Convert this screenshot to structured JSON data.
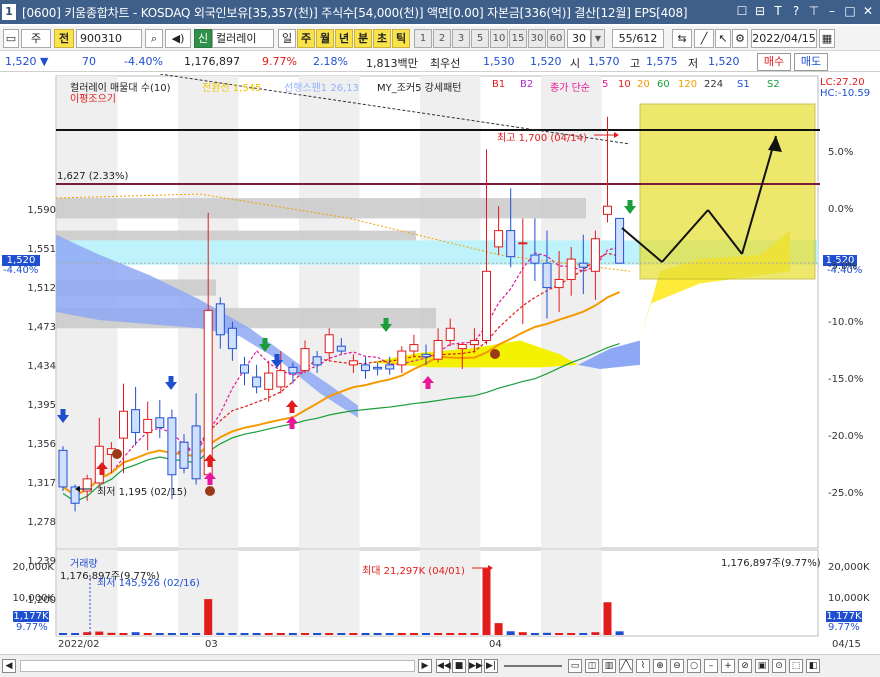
{
  "window": {
    "number": "1",
    "title": "[0600] 키움종합차트 - KOSDAQ 외국인보유[35,357(천)] 주식수[54,000(천)] 액면[0.00] 자본금[336(억)] 결산[12월] EPS[408]",
    "icons": [
      "restore-icon",
      "minimize-icon",
      "text-icon",
      "question-icon",
      "pin-icon",
      "window-minimize-icon",
      "maximize-icon",
      "close-icon"
    ],
    "icon_glyphs": [
      "☐",
      "⊟",
      "T",
      "?",
      "⊤",
      "–",
      "□",
      "✕"
    ]
  },
  "toolbar": {
    "market": "주",
    "jeon": "전",
    "code": "900310",
    "search_glyph": "🔍",
    "sound_glyph": "◀)",
    "new_label": "신",
    "stock_name": "컬러레이",
    "periods": [
      "일",
      "주",
      "월",
      "년",
      "분",
      "초",
      "틱"
    ],
    "intervals": [
      "1",
      "2",
      "3",
      "5",
      "10",
      "15",
      "30",
      "60"
    ],
    "interval_value": "30",
    "page": "55/612",
    "date": "2022/04/15"
  },
  "quote": {
    "price": "1,520",
    "change_arrow": "▼",
    "change": "70",
    "change_pct": "-4.40%",
    "volume": "1,176,897",
    "volume_ratio": "9.77%",
    "amount": "2.18%",
    "amount_value": "1,813백만",
    "best_label": "최우선",
    "best_ask": "1,530",
    "best_bid": "1,520",
    "open_label": "시",
    "open": "1,570",
    "high_label": "고",
    "high": "1,575",
    "low_label": "저",
    "low": "1,520",
    "buy_button": "매수",
    "sell_button": "매도"
  },
  "legend": {
    "name": "컬러레이 매물대 수(10)",
    "second_line": "이평조으기",
    "conversion": "전환선 1,545",
    "lead": "선행스팬1 26,13",
    "pattern": "MY_조커5 강세패턴",
    "b1": "B1",
    "b2": "B2",
    "ma_label": "종가 단순",
    "ma_periods": [
      "5",
      "10",
      "20",
      "60",
      "120",
      "224"
    ],
    "s1": "S1",
    "s2": "S2",
    "lc": "LC:27.20",
    "hc": "HC:-10.59",
    "colors": {
      "ma5": "#e8169a",
      "ma10": "#e21b1b",
      "ma20": "#f59a00",
      "ma60": "#1a9e3a",
      "ma120": "#f0a000",
      "ma224": "#333333",
      "s1": "#1f4fd1",
      "s2": "#1a9e3a"
    }
  },
  "annotations": {
    "high_marker": "최고 1,700 (04/14)",
    "low_marker": "최저 1,195 (02/15)",
    "upper_line": "1,627 (2.33%)",
    "current_left": "1,520",
    "current_left_pct": "-4.40%",
    "current_right": "1,520",
    "current_right_pct": "-4.40%"
  },
  "axes": {
    "left_ticks": [
      "1,590",
      "1,551",
      "1,512",
      "1,473",
      "1,434",
      "1,395",
      "1,356",
      "1,317",
      "1,278",
      "1,239",
      "1,200"
    ],
    "right_ticks": [
      "5.0%",
      "0.0%",
      "-5.0%",
      "-10.0%",
      "-15.0%",
      "-20.0%",
      "-25.0%"
    ],
    "volume_left_ticks": [
      "20,000K",
      "10,000K"
    ],
    "volume_right_ticks": [
      "20,000K",
      "10,000K"
    ],
    "x_labels": [
      "2022/02",
      "03",
      "04"
    ],
    "x_right": "04/15"
  },
  "volume_panel": {
    "title": "거래량",
    "current": "1,176,897주(9.77%)",
    "current_right": "1,176,897주(9.77%)",
    "min_marker": "최저 145,926 (02/16)",
    "max_marker": "최대 21,297K (04/01)",
    "current_k": "1,177K",
    "current_pct": "9.77%"
  },
  "chart_data": {
    "type": "candlestick",
    "ylim": [
      1170,
      1750
    ],
    "candles": [
      {
        "o": 1290,
        "h": 1295,
        "l": 1240,
        "c": 1245
      },
      {
        "o": 1245,
        "h": 1248,
        "l": 1215,
        "c": 1225
      },
      {
        "o": 1240,
        "h": 1260,
        "l": 1228,
        "c": 1255
      },
      {
        "o": 1250,
        "h": 1330,
        "l": 1245,
        "c": 1295
      },
      {
        "o": 1285,
        "h": 1300,
        "l": 1262,
        "c": 1292
      },
      {
        "o": 1305,
        "h": 1372,
        "l": 1262,
        "c": 1338
      },
      {
        "o": 1340,
        "h": 1368,
        "l": 1296,
        "c": 1312
      },
      {
        "o": 1312,
        "h": 1350,
        "l": 1290,
        "c": 1328
      },
      {
        "o": 1330,
        "h": 1352,
        "l": 1305,
        "c": 1318
      },
      {
        "o": 1330,
        "h": 1340,
        "l": 1230,
        "c": 1260
      },
      {
        "o": 1300,
        "h": 1310,
        "l": 1262,
        "c": 1268
      },
      {
        "o": 1320,
        "h": 1360,
        "l": 1248,
        "c": 1255
      },
      {
        "o": 1260,
        "h": 1582,
        "l": 1255,
        "c": 1462
      },
      {
        "o": 1470,
        "h": 1478,
        "l": 1415,
        "c": 1432
      },
      {
        "o": 1440,
        "h": 1448,
        "l": 1400,
        "c": 1415
      },
      {
        "o": 1395,
        "h": 1405,
        "l": 1370,
        "c": 1385
      },
      {
        "o": 1380,
        "h": 1395,
        "l": 1360,
        "c": 1368
      },
      {
        "o": 1365,
        "h": 1400,
        "l": 1350,
        "c": 1385
      },
      {
        "o": 1368,
        "h": 1412,
        "l": 1360,
        "c": 1388
      },
      {
        "o": 1392,
        "h": 1398,
        "l": 1372,
        "c": 1385
      },
      {
        "o": 1388,
        "h": 1425,
        "l": 1385,
        "c": 1415
      },
      {
        "o": 1405,
        "h": 1412,
        "l": 1385,
        "c": 1395
      },
      {
        "o": 1410,
        "h": 1440,
        "l": 1400,
        "c": 1432
      },
      {
        "o": 1418,
        "h": 1428,
        "l": 1408,
        "c": 1412
      },
      {
        "o": 1395,
        "h": 1408,
        "l": 1385,
        "c": 1400
      },
      {
        "o": 1395,
        "h": 1405,
        "l": 1378,
        "c": 1388
      },
      {
        "o": 1392,
        "h": 1398,
        "l": 1382,
        "c": 1390
      },
      {
        "o": 1395,
        "h": 1405,
        "l": 1383,
        "c": 1390
      },
      {
        "o": 1395,
        "h": 1418,
        "l": 1385,
        "c": 1412
      },
      {
        "o": 1412,
        "h": 1432,
        "l": 1405,
        "c": 1420
      },
      {
        "o": 1408,
        "h": 1420,
        "l": 1395,
        "c": 1405
      },
      {
        "o": 1402,
        "h": 1440,
        "l": 1398,
        "c": 1425
      },
      {
        "o": 1425,
        "h": 1452,
        "l": 1418,
        "c": 1440
      },
      {
        "o": 1415,
        "h": 1422,
        "l": 1390,
        "c": 1420
      },
      {
        "o": 1420,
        "h": 1440,
        "l": 1410,
        "c": 1425
      },
      {
        "o": 1425,
        "h": 1660,
        "l": 1420,
        "c": 1510
      },
      {
        "o": 1540,
        "h": 1590,
        "l": 1530,
        "c": 1560
      },
      {
        "o": 1560,
        "h": 1612,
        "l": 1515,
        "c": 1528
      },
      {
        "o": 1545,
        "h": 1575,
        "l": 1445,
        "c": 1545
      },
      {
        "o": 1530,
        "h": 1575,
        "l": 1498,
        "c": 1520
      },
      {
        "o": 1520,
        "h": 1560,
        "l": 1452,
        "c": 1490
      },
      {
        "o": 1490,
        "h": 1535,
        "l": 1460,
        "c": 1500
      },
      {
        "o": 1500,
        "h": 1540,
        "l": 1480,
        "c": 1525
      },
      {
        "o": 1520,
        "h": 1555,
        "l": 1482,
        "c": 1515
      },
      {
        "o": 1510,
        "h": 1560,
        "l": 1475,
        "c": 1550
      },
      {
        "o": 1580,
        "h": 1700,
        "l": 1570,
        "c": 1590
      },
      {
        "o": 1575,
        "h": 1575,
        "l": 1520,
        "c": 1520
      }
    ],
    "volume_k": [
      150,
      160,
      900,
      1100,
      700,
      500,
      900,
      400,
      350,
      500,
      400,
      500,
      11500,
      700,
      500,
      400,
      300,
      250,
      350,
      450,
      400,
      300,
      300,
      400,
      300,
      250,
      300,
      400,
      500,
      400,
      350,
      450,
      300,
      250,
      500,
      21297,
      3800,
      1200,
      900,
      500,
      700,
      600,
      400,
      600,
      900,
      10500,
      1177
    ],
    "volume_ylim": [
      0,
      25000
    ]
  }
}
